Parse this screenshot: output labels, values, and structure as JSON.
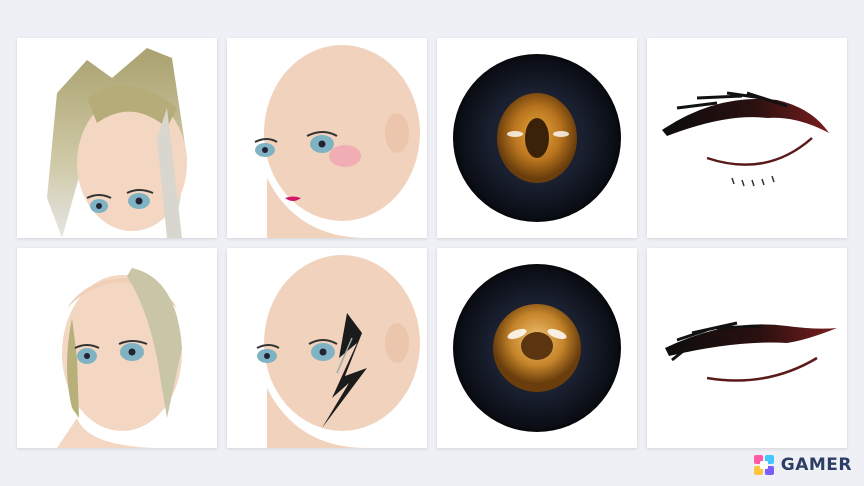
{
  "watermark": {
    "text": "GAMER",
    "icon": "gamer-logo-icon",
    "colors": [
      "#ff5aa5",
      "#42c8ff",
      "#ffc43d",
      "#7b5cff"
    ]
  },
  "grid": {
    "rows": [
      [
        "hairstyle-twin-tails",
        "face-makeup-blush-lipstick",
        "eye-amber-iris-oval-pupil",
        "eyelash-dark-red-style-1"
      ],
      [
        "hairstyle-side-swept",
        "face-cracked-mechanical-pattern",
        "eye-amber-iris-round-pupil",
        "eyelash-dark-red-style-2"
      ]
    ]
  },
  "colors": {
    "page_bg": "#eef0f5",
    "skin": "#f3d7c3",
    "hair": "#c2b888",
    "iris": "#b8741e",
    "eyelash": "#7a1e1e"
  }
}
